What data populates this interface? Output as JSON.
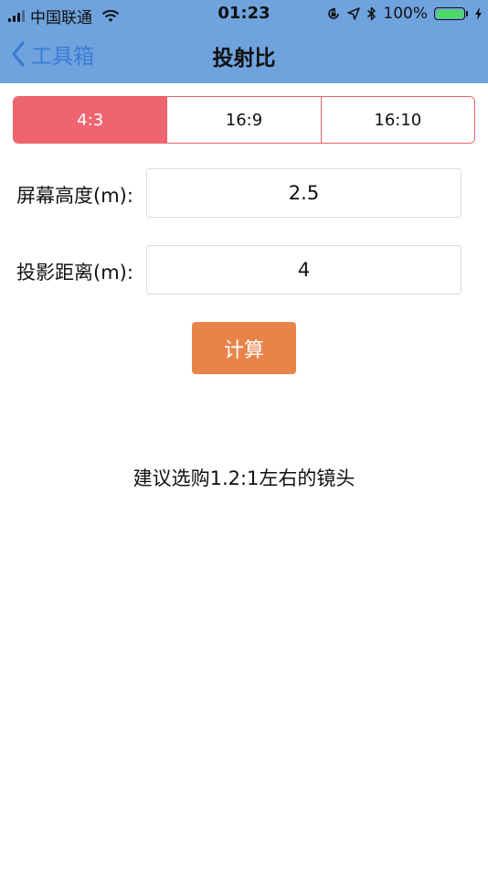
{
  "status_bar": {
    "carrier": "中国联通",
    "time": "01:23",
    "battery": "100%"
  },
  "nav": {
    "back_label": "工具箱",
    "title": "投射比"
  },
  "aspect_tabs": [
    {
      "label": "4:3",
      "active": true
    },
    {
      "label": "16:9",
      "active": false
    },
    {
      "label": "16:10",
      "active": false
    }
  ],
  "form": {
    "screen_height": {
      "label": "屏幕高度(m):",
      "value": "2.5"
    },
    "projection_distance": {
      "label": "投影距离(m):",
      "value": "4"
    }
  },
  "calculate_label": "计算",
  "result_text": "建议选购1.2:1左右的镜头",
  "colors": {
    "nav_bg": "#6fa3de",
    "back_link": "#3a7bd5",
    "tab_active": "#ee6570",
    "tab_border": "#e8636c",
    "button": "#e8844a"
  }
}
